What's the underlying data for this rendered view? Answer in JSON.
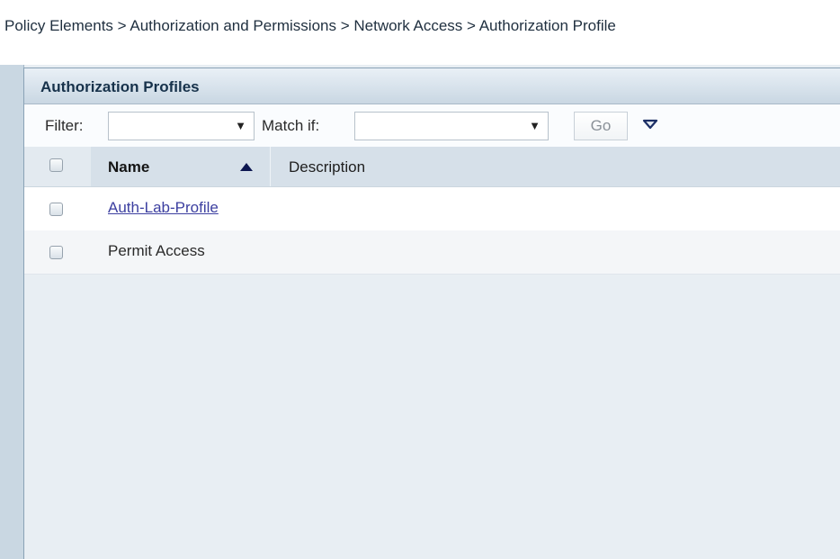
{
  "breadcrumb": {
    "text": "Policy Elements > Authorization and Permissions  > Network Access > Authorization Profile"
  },
  "panel": {
    "title": "Authorization Profiles"
  },
  "filter_bar": {
    "filter_label": "Filter:",
    "filter_value": "",
    "match_label": "Match if:",
    "match_value": "",
    "go_label": "Go",
    "dropdown_toggle_icon": "triangle-down-icon"
  },
  "table": {
    "columns": [
      {
        "label": "Name"
      },
      {
        "label": "Description"
      }
    ],
    "rows": [
      {
        "name": "Auth-Lab-Profile",
        "description": ""
      },
      {
        "name": "Permit Access",
        "description": ""
      }
    ],
    "sort_icon": "sort-ascending-icon"
  },
  "colors": {
    "link": "#3c3fa0",
    "title_text": "#17324b",
    "panel_background": "#e8eef3",
    "header_background": "#d6e0e9"
  }
}
